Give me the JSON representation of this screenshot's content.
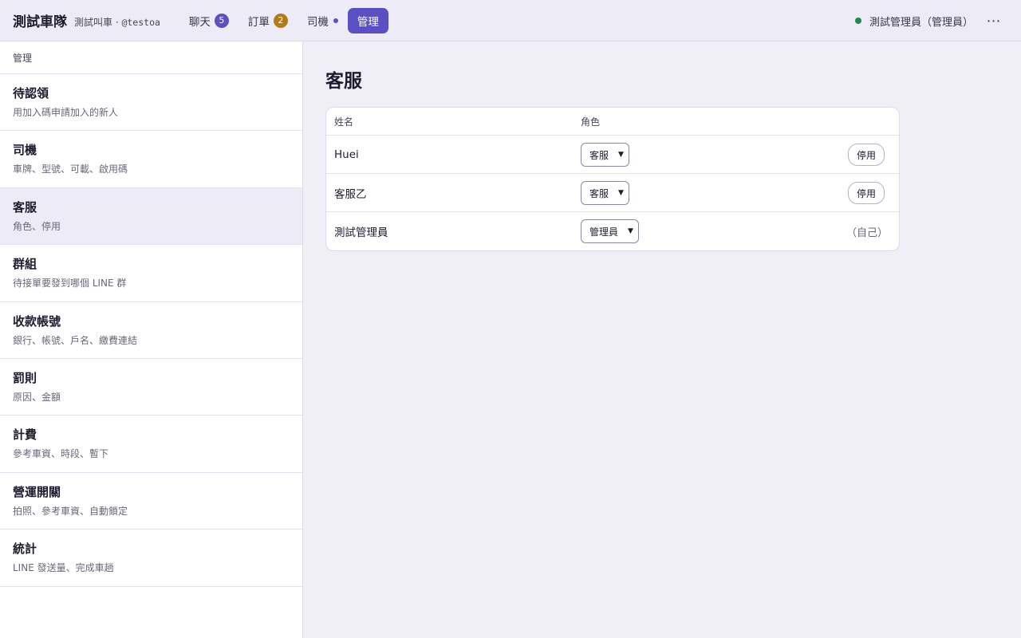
{
  "app": {
    "brand": "測試車隊",
    "subtitle": "測試叫車 · ",
    "handle": "@testoa"
  },
  "nav": {
    "chat": {
      "label": "聊天",
      "badge": "5",
      "badge_color": "#5b4fc4"
    },
    "orders": {
      "label": "訂單",
      "badge": "2",
      "badge_color": "#b07a1e"
    },
    "drivers": {
      "label": "司機",
      "dot_color": "#5b4fc4"
    },
    "admin": {
      "label": "管理"
    }
  },
  "user": {
    "status_color": "#1e8a4c",
    "label": "測試管理員（管理員）",
    "more": "⋯"
  },
  "sidebar": {
    "header": "管理",
    "items": [
      {
        "title": "待認領",
        "desc": "用加入碼申請加入的新人"
      },
      {
        "title": "司機",
        "desc": "車牌、型號、可載、啟用碼"
      },
      {
        "title": "客服",
        "desc": "角色、停用"
      },
      {
        "title": "群組",
        "desc": "待接單要發到哪個 LINE 群"
      },
      {
        "title": "收款帳號",
        "desc": "銀行、帳號、戶名、繳費連結"
      },
      {
        "title": "罰則",
        "desc": "原因、金額"
      },
      {
        "title": "計費",
        "desc": "參考車資、時段、暫下"
      },
      {
        "title": "營運開關",
        "desc": "拍照、參考車資、自動鎖定"
      },
      {
        "title": "統計",
        "desc": "LINE 發送量、完成車趟"
      }
    ],
    "selected_index": 2
  },
  "main": {
    "title": "客服",
    "table": {
      "headers": {
        "name": "姓名",
        "role": "角色"
      },
      "rows": [
        {
          "name": "Huei",
          "role": "客服",
          "action": "停用"
        },
        {
          "name": "客服乙",
          "role": "客服",
          "action": "停用"
        },
        {
          "name": "測試管理員",
          "role": "管理員",
          "note": "（自己）"
        }
      ]
    }
  }
}
